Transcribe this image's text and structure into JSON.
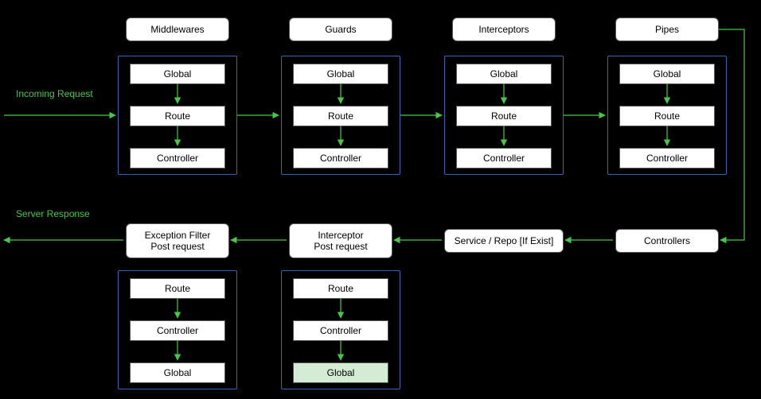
{
  "labels": {
    "incoming": "Incoming Request",
    "response": "Server Response"
  },
  "top_titles": {
    "middlewares": "Middlewares",
    "guards": "Guards",
    "interceptors": "Interceptors",
    "pipes": "Pipes"
  },
  "bottom_titles": {
    "exception": "Exception Filter\nPost request",
    "interceptor_post": "Interceptor\nPost request",
    "service_repo": "Service / Repo [If Exist]",
    "controllers": "Controllers"
  },
  "top_items": {
    "a": "Global",
    "b": "Route",
    "c": "Controller"
  },
  "bottom_items": {
    "a": "Route",
    "b": "Controller",
    "c": "Global"
  }
}
